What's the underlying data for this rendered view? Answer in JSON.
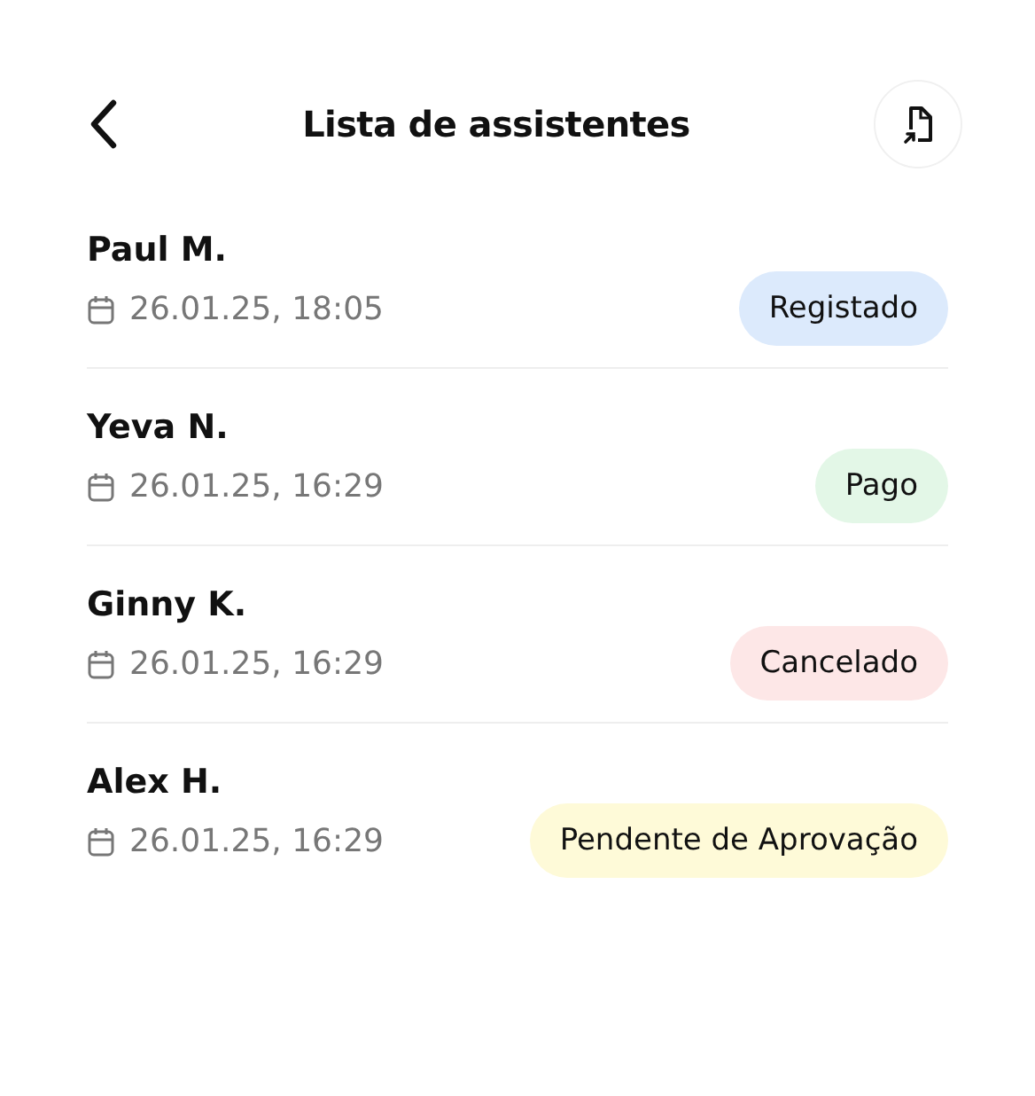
{
  "header": {
    "title": "Lista de assistentes"
  },
  "attendees": [
    {
      "name": "Paul M.",
      "date": "26.01.25, 18:05",
      "status": "Registado",
      "color": "#dceafc"
    },
    {
      "name": "Yeva N.",
      "date": "26.01.25, 16:29",
      "status": "Pago",
      "color": "#e3f7e7"
    },
    {
      "name": "Ginny K.",
      "date": "26.01.25, 16:29",
      "status": "Cancelado",
      "color": "#fde7e7"
    },
    {
      "name": "Alex H.",
      "date": "26.01.25, 16:29",
      "status": "Pendente de Aprovação",
      "color": "#fefad8"
    }
  ]
}
